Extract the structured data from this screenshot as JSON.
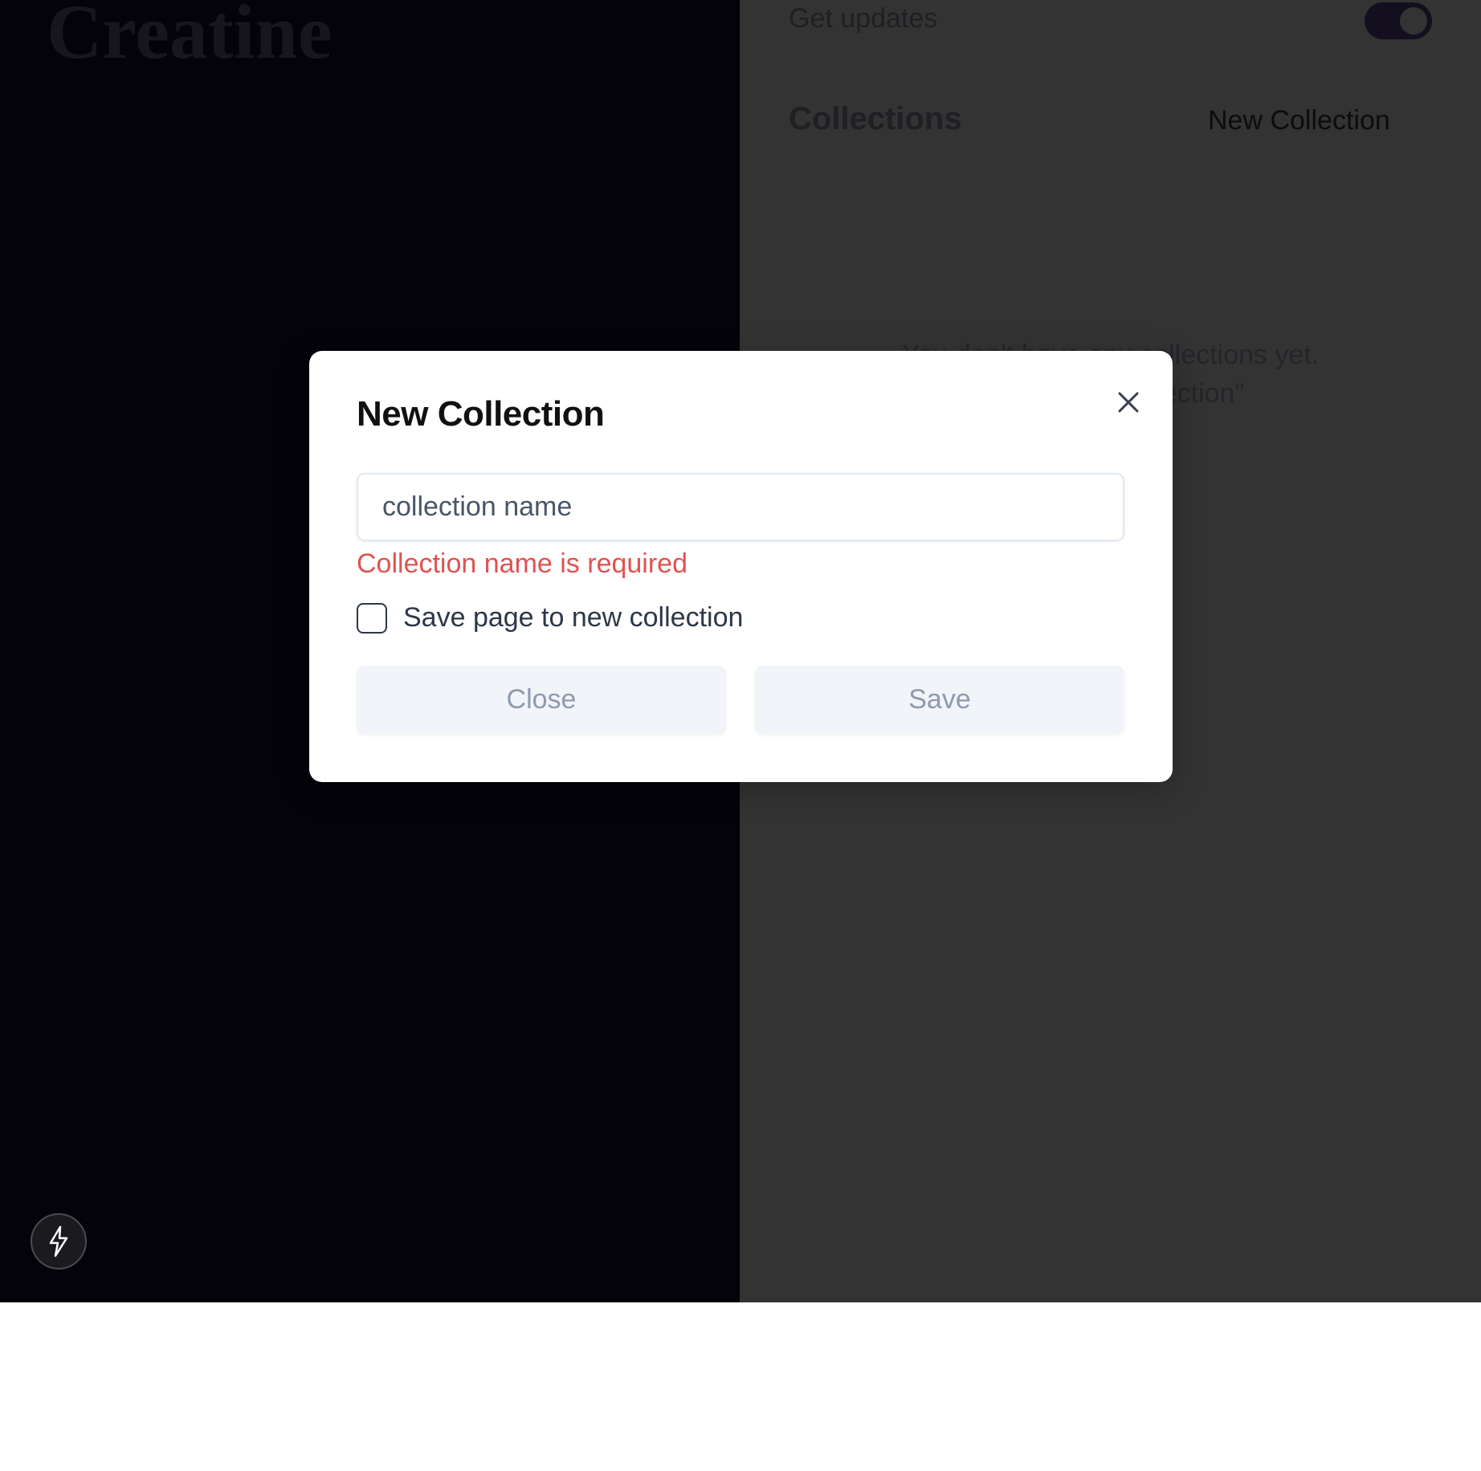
{
  "brand": {
    "title": "Creatine"
  },
  "sidebar": {
    "updates_label": "Get updates",
    "updates_enabled": true,
    "collections_heading": "Collections",
    "new_collection_label": "New Collection",
    "empty_line_1": "You don't have any collections yet.",
    "empty_line_2": "Click \"New Collection\""
  },
  "badge": {
    "icon": "lightning-icon"
  },
  "modal": {
    "title": "New Collection",
    "close_icon": "close-icon",
    "input": {
      "value": "",
      "placeholder": "collection name"
    },
    "error": "Collection name is required",
    "checkbox_label": "Save page to new collection",
    "checkbox_checked": false,
    "close_button": "Close",
    "save_button": "Save"
  },
  "colors": {
    "left_bg": "#04030a",
    "right_bg": "#333333",
    "error": "#e05252",
    "button_bg": "#f1f4f9",
    "button_text": "#8e9aae"
  }
}
